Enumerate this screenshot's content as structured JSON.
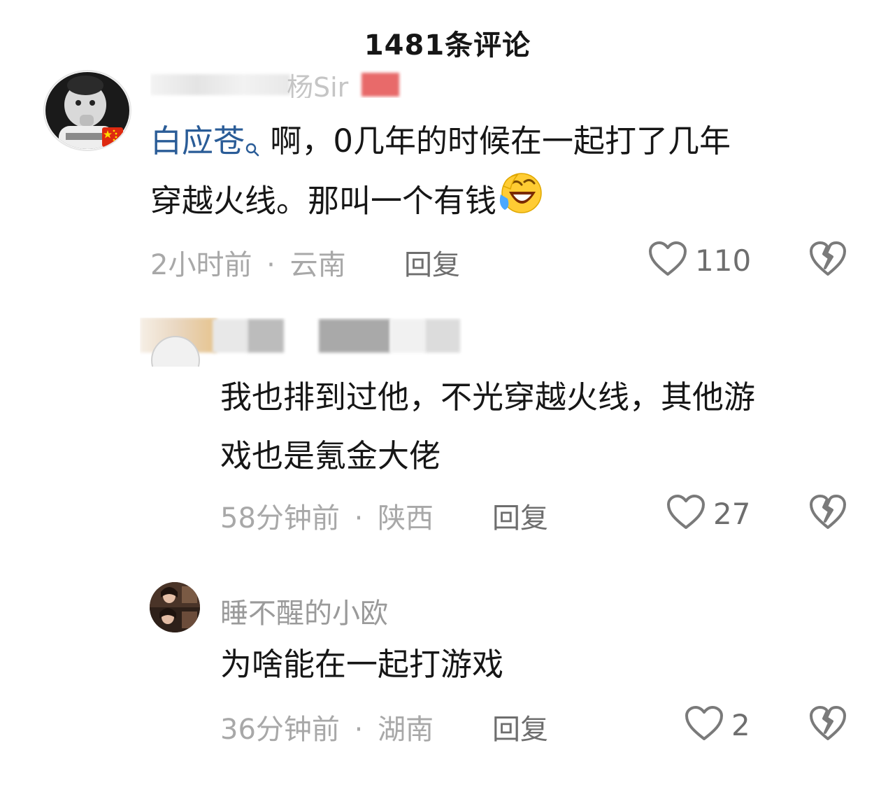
{
  "header": {
    "title": "1481条评论"
  },
  "comments": [
    {
      "username": "杨Sir",
      "mention": "白应苍",
      "text_line1": "啊，0几年的时候在一起打了几年",
      "text_line2": "穿越火线。那叫一个有钱",
      "time": "2小时前",
      "location": "云南",
      "reply_label": "回复",
      "likes": "110"
    },
    {
      "text_line1": "我也排到过他，不光穿越火线，其他游",
      "text_line2": "戏也是氪金大佬",
      "time": "58分钟前",
      "location": "陕西",
      "reply_label": "回复",
      "likes": "27"
    },
    {
      "username": "睡不醒的小欧",
      "text_line1": "为啥能在一起打游戏",
      "time": "36分钟前",
      "location": "湖南",
      "reply_label": "回复",
      "likes": "2"
    }
  ],
  "separator": "·",
  "colors": {
    "mention": "#2a5c97",
    "meta": "#a8a8a8",
    "text": "#161616"
  },
  "icons": [
    "heart-outline-icon",
    "broken-heart-icon",
    "search-icon",
    "laugh-cry-emoji",
    "china-flag-icon"
  ]
}
